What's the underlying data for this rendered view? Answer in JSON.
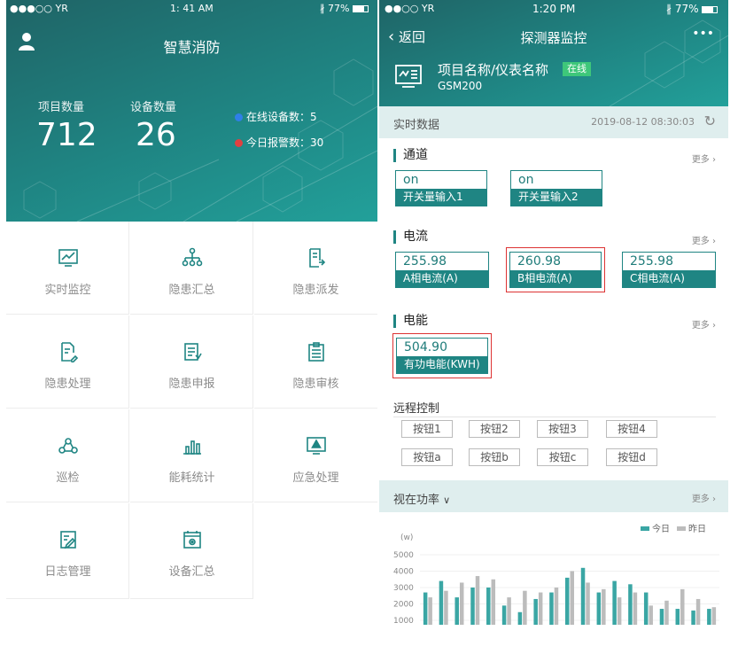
{
  "left": {
    "status": {
      "carrier": "●●●○○ YR",
      "time": "1: 41 AM",
      "battery": "77%"
    },
    "title": "智慧消防",
    "stats": [
      {
        "label": "项目数量",
        "value": "712"
      },
      {
        "label": "设备数量",
        "value": "26"
      }
    ],
    "kpis": [
      {
        "label": "在线设备数：",
        "value": "5",
        "color": "#2f7fe8"
      },
      {
        "label": "今日报警数：",
        "value": "30",
        "color": "#e04040"
      }
    ],
    "menu": [
      {
        "label": "实时监控",
        "icon": "trend-chart-icon"
      },
      {
        "label": "隐患汇总",
        "icon": "hierarchy-icon"
      },
      {
        "label": "隐患派发",
        "icon": "dispatch-doc-icon"
      },
      {
        "label": "隐患处理",
        "icon": "edit-doc-icon"
      },
      {
        "label": "隐患申报",
        "icon": "report-doc-icon"
      },
      {
        "label": "隐患审核",
        "icon": "clipboard-icon"
      },
      {
        "label": "巡检",
        "icon": "patrol-icon"
      },
      {
        "label": "能耗统计",
        "icon": "bar-stats-icon"
      },
      {
        "label": "应急处理",
        "icon": "warning-monitor-icon"
      },
      {
        "label": "日志管理",
        "icon": "log-edit-icon"
      },
      {
        "label": "设备汇总",
        "icon": "device-gear-icon"
      }
    ]
  },
  "right": {
    "status": {
      "carrier": "●●○○ YR",
      "time": "1:20 PM",
      "battery": "77%"
    },
    "nav": {
      "back": "返回",
      "title": "探测器监控",
      "more": "•••"
    },
    "device": {
      "name": "项目名称/仪表名称",
      "status": "在线",
      "model": "GSM200"
    },
    "realtime": {
      "label": "实时数据",
      "timestamp": "2019-08-12 08:30:03"
    },
    "channel": {
      "title": "通道",
      "more": "更多",
      "items": [
        {
          "value": "on",
          "name": "开关量输入1"
        },
        {
          "value": "on",
          "name": "开关量输入2"
        }
      ]
    },
    "current": {
      "title": "电流",
      "more": "更多",
      "items": [
        {
          "value": "255.98",
          "name": "A相电流(A)"
        },
        {
          "value": "260.98",
          "name": "B相电流(A)"
        },
        {
          "value": "255.98",
          "name": "C相电流(A)"
        }
      ]
    },
    "energy": {
      "title": "电能",
      "more": "更多",
      "items": [
        {
          "value": "504.90",
          "name": "有功电能(KWH)"
        }
      ]
    },
    "remote": {
      "title": "远程控制",
      "buttons": [
        "按钮1",
        "按钮2",
        "按钮3",
        "按钮4",
        "按钮a",
        "按钮b",
        "按钮c",
        "按钮d"
      ]
    },
    "power": {
      "title": "视在功率",
      "more": "更多"
    },
    "colors": {
      "accent": "#1f8583",
      "today": "#3aa6a4",
      "yesterday": "#bcbcbc",
      "highlight": "#d33333"
    }
  },
  "chart_data": {
    "type": "bar",
    "ylabel": "(w)",
    "ylim": [
      1000,
      5000
    ],
    "yticks": [
      "5000",
      "4000",
      "3000",
      "2000",
      "1000"
    ],
    "series": [
      {
        "name": "今日",
        "values": [
          2700,
          3400,
          2400,
          3000,
          3000,
          1900,
          1500,
          2300,
          2700,
          3600,
          4200,
          2700,
          3400,
          3200,
          2700,
          1700,
          1700,
          1600,
          1700
        ]
      },
      {
        "name": "昨日",
        "values": [
          2400,
          2800,
          3300,
          3700,
          3500,
          2400,
          2800,
          2700,
          3000,
          4000,
          3300,
          2900,
          2400,
          2700,
          1900,
          2200,
          2900,
          2300,
          1800
        ]
      }
    ]
  }
}
